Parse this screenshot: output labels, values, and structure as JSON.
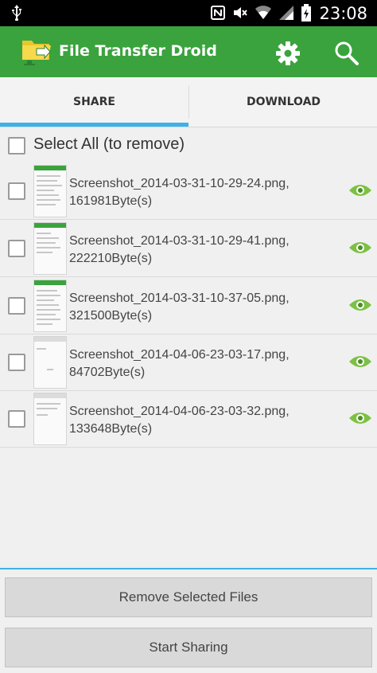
{
  "status_bar": {
    "time": "23:08",
    "icons": [
      "usb-icon",
      "nfc-icon",
      "mute-icon",
      "wifi-icon",
      "signal-icon",
      "battery-icon"
    ]
  },
  "app": {
    "title": "File Transfer Droid",
    "accent_color": "#3aa33d",
    "indicator_color": "#3cb2e8"
  },
  "tabs": [
    {
      "label": "SHARE",
      "selected": true
    },
    {
      "label": "DOWNLOAD",
      "selected": false
    }
  ],
  "select_all": {
    "label": "Select All (to remove)",
    "checked": false
  },
  "files": [
    {
      "name": "Screenshot_2014-03-31-10-29-24.png,",
      "size": "161981Byte(s)"
    },
    {
      "name": "Screenshot_2014-03-31-10-29-41.png,",
      "size": "222210Byte(s)"
    },
    {
      "name": "Screenshot_2014-03-31-10-37-05.png,",
      "size": "321500Byte(s)"
    },
    {
      "name": "Screenshot_2014-04-06-23-03-17.png,",
      "size": "84702Byte(s)"
    },
    {
      "name": "Screenshot_2014-04-06-23-03-32.png,",
      "size": "133648Byte(s)"
    }
  ],
  "buttons": {
    "remove_label": "Remove Selected Files",
    "start_label": "Start Sharing"
  }
}
